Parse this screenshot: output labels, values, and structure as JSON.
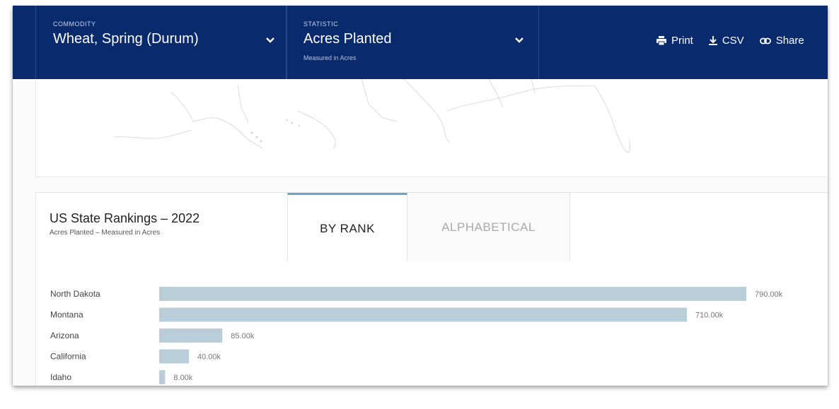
{
  "header": {
    "commodity": {
      "caption": "COMMODITY",
      "value": "Wheat, Spring (Durum)"
    },
    "statistic": {
      "caption": "STATISTIC",
      "value": "Acres Planted",
      "sub": "Measured in Acres"
    },
    "actions": {
      "print": "Print",
      "csv": "CSV",
      "share": "Share"
    }
  },
  "rankings": {
    "title": "US State Rankings – 2022",
    "subtitle": "Acres Planted – Measured in Acres",
    "tabs": {
      "by_rank": "BY RANK",
      "alphabetical": "ALPHABETICAL"
    }
  },
  "chart_data": {
    "type": "bar",
    "orientation": "horizontal",
    "categories": [
      "North Dakota",
      "Montana",
      "Arizona",
      "California",
      "Idaho"
    ],
    "values": [
      790000,
      710000,
      85000,
      40000,
      8000
    ],
    "value_labels": [
      "790.00k",
      "710.00k",
      "85.00k",
      "40.00k",
      "8.00k"
    ],
    "bar_color": "#b9ced9"
  },
  "colors": {
    "header_bg": "#0a2a6e",
    "tab_accent": "#6fa3c9"
  }
}
